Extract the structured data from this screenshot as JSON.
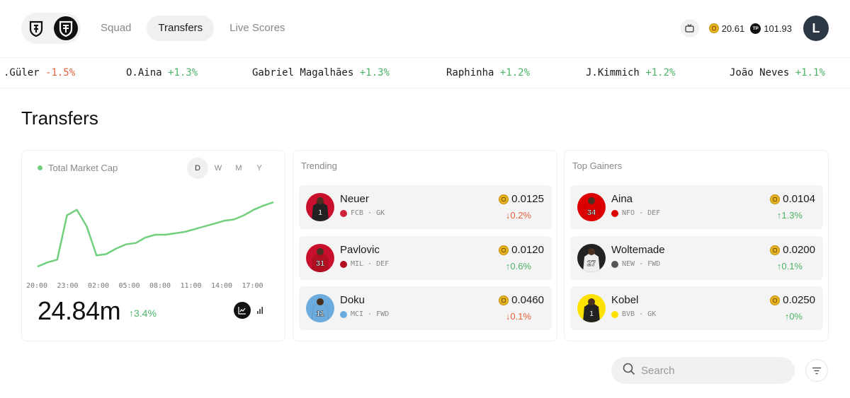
{
  "header": {
    "nav": [
      "Squad",
      "Transfers",
      "Live Scores"
    ],
    "active_tab": "Transfers",
    "icons": [
      "shield-logo-icon",
      "crest-logo-icon",
      "tv-icon"
    ],
    "coin_balance": "20.61",
    "tp_badge": "TP",
    "tp_balance": "101.93",
    "avatar_initial": "L"
  },
  "ticker": [
    {
      "name": ".Güler",
      "change": "-1.5%"
    },
    {
      "name": "O.Aina",
      "change": "+1.3%"
    },
    {
      "name": "Gabriel Magalhães",
      "change": "+1.3%"
    },
    {
      "name": "Raphinha",
      "change": "+1.2%"
    },
    {
      "name": "J.Kimmich",
      "change": "+1.2%"
    },
    {
      "name": "João Neves",
      "change": "+1.1%"
    }
  ],
  "page_title": "Transfers",
  "market_cap": {
    "label": "Total Market Cap",
    "periods": [
      "D",
      "W",
      "M",
      "Y"
    ],
    "active_period": "D",
    "value": "24.84m",
    "change": "↑3.4%",
    "chart_types": [
      "line-chart-icon",
      "bar-chart-icon"
    ]
  },
  "chart_data": {
    "type": "line",
    "x": [
      "20:00",
      "23:00",
      "02:00",
      "05:00",
      "08:00",
      "11:00",
      "14:00",
      "17:00"
    ],
    "points_t": [
      0,
      1,
      2,
      3,
      4,
      5,
      6,
      7,
      8,
      9,
      10,
      11,
      12,
      13,
      14,
      15,
      16,
      17,
      18,
      19,
      20,
      21,
      22,
      23,
      24,
      25,
      26,
      27,
      28,
      29,
      30,
      31,
      32,
      33,
      34,
      35,
      36
    ],
    "note_hours_from_2000": "",
    "series": [
      {
        "name": "",
        "color": "#72cf7e",
        "x_hours": [
          0,
          1,
          2,
          3,
          4,
          5,
          6,
          7,
          8,
          9,
          10,
          11,
          12,
          13,
          14,
          15,
          16,
          17,
          18,
          19,
          20,
          21,
          22,
          23,
          24
        ],
        "values": [
          20.2,
          20.5,
          20.7,
          23.9,
          24.3,
          23.1,
          21.0,
          21.1,
          21.5,
          21.8,
          21.9,
          22.3,
          22.5,
          22.5,
          22.6,
          22.7,
          22.9,
          23.1,
          23.3,
          23.5,
          23.6,
          23.9,
          24.3,
          24.6,
          24.84
        ]
      }
    ],
    "ylim": [
      20.0,
      25.2
    ],
    "grid": false,
    "xlabel": "",
    "ylabel": "",
    "title": ""
  },
  "trending": {
    "title": "Trending",
    "players": [
      {
        "name": "Neuer",
        "club": "FCB",
        "pos": "GK",
        "price": "0.0125",
        "change": "↓0.2%",
        "dir": "neg",
        "shirt_color": "#c8102e",
        "number": "1",
        "kit": "#222",
        "club_color": "#d0223b"
      },
      {
        "name": "Pavlovic",
        "club": "MIL",
        "pos": "DEF",
        "price": "0.0120",
        "change": "↑0.6%",
        "dir": "pos",
        "shirt_color": "#c8102e",
        "number": "31",
        "kit": "#b01020",
        "club_color": "#b01020"
      },
      {
        "name": "Doku",
        "club": "MCI",
        "pos": "FWD",
        "price": "0.0460",
        "change": "↓0.1%",
        "dir": "neg",
        "shirt_color": "#6cabdd",
        "number": "11",
        "kit": "#6cabdd",
        "club_color": "#6cabdd"
      }
    ]
  },
  "gainers": {
    "title": "Top Gainers",
    "players": [
      {
        "name": "Aina",
        "club": "NFO",
        "pos": "DEF",
        "price": "0.0104",
        "change": "↑1.3%",
        "dir": "pos",
        "shirt_color": "#dd0000",
        "number": "34",
        "kit": "#dd0000",
        "club_color": "#dd0000"
      },
      {
        "name": "Woltemade",
        "club": "NEW",
        "pos": "FWD",
        "price": "0.0200",
        "change": "↑0.1%",
        "dir": "pos",
        "shirt_color": "#222",
        "number": "27",
        "kit": "#eee",
        "club_color": "#555"
      },
      {
        "name": "Kobel",
        "club": "BVB",
        "pos": "GK",
        "price": "0.0250",
        "change": "↑0%",
        "dir": "pos",
        "shirt_color": "#fde100",
        "number": "1",
        "kit": "#222",
        "club_color": "#fde100"
      }
    ]
  },
  "search": {
    "placeholder": "Search",
    "value": ""
  },
  "filter_icon": "filter-icon"
}
